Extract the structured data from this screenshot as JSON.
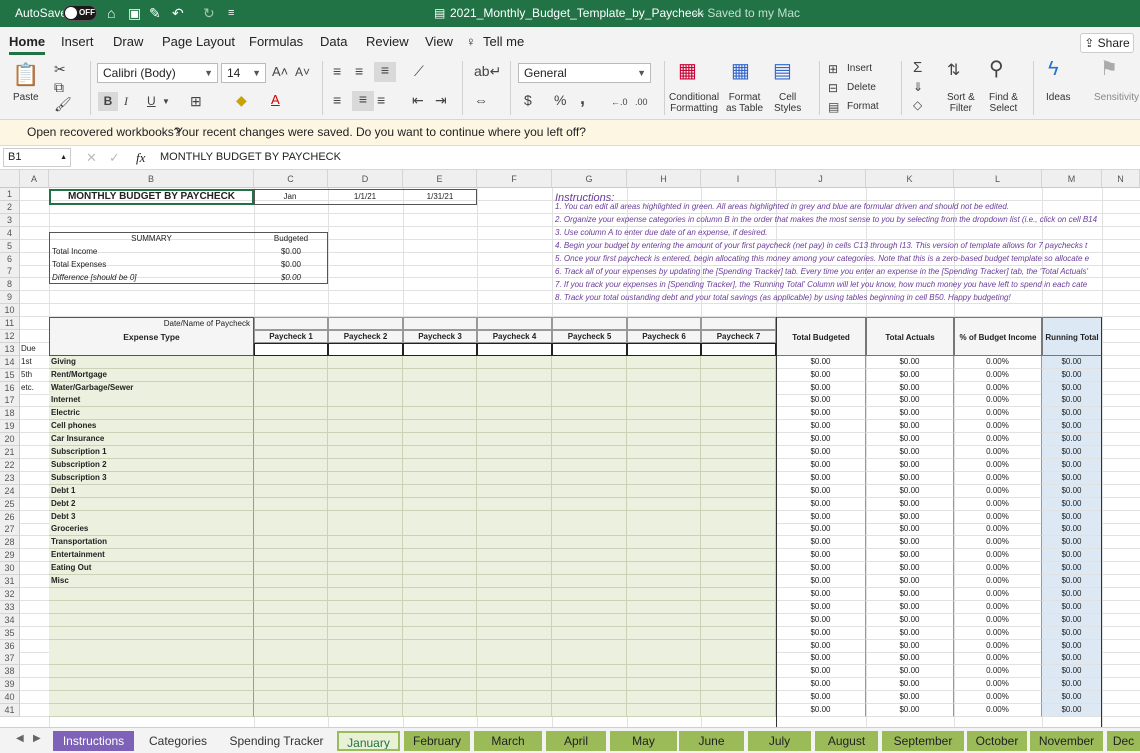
{
  "titlebar": {
    "autosave_label": "AutoSave",
    "autosave_state": "OFF",
    "filename": "2021_Monthly_Budget_Template_by_Paycheck",
    "saved_status": "— Saved to my Mac",
    "color": "#217346"
  },
  "ribbon_tabs": [
    "Home",
    "Insert",
    "Draw",
    "Page Layout",
    "Formulas",
    "Data",
    "Review",
    "View",
    "Tell me"
  ],
  "share_label": "Share",
  "ribbon": {
    "paste": "Paste",
    "font_name": "Calibri (Body)",
    "font_size": "14",
    "number_format": "General",
    "conditional": [
      "Conditional",
      "Formatting"
    ],
    "format_table": [
      "Format",
      "as Table"
    ],
    "cell_styles": [
      "Cell",
      "Styles"
    ],
    "insert": "Insert",
    "delete": "Delete",
    "format": "Format",
    "sort": [
      "Sort &",
      "Filter"
    ],
    "find": [
      "Find &",
      "Select"
    ],
    "ideas": "Ideas",
    "sensitivity": "Sensitivity",
    "bold": "B",
    "italic": "I",
    "underline": "U"
  },
  "banner": {
    "title": "Open recovered workbooks?",
    "message": "Your recent changes were saved. Do you want to continue where you left off?"
  },
  "formula_bar": {
    "name_box": "B1",
    "fx": "fx",
    "content": "MONTHLY BUDGET BY PAYCHECK"
  },
  "columns": [
    "A",
    "B",
    "C",
    "D",
    "E",
    "F",
    "G",
    "H",
    "I",
    "J",
    "K",
    "L",
    "M",
    "N"
  ],
  "rows": [
    "1",
    "2",
    "3",
    "4",
    "5",
    "6",
    "7",
    "8",
    "9",
    "10",
    "11",
    "12",
    "13",
    "14",
    "15",
    "16",
    "17",
    "18",
    "19",
    "20",
    "21",
    "22",
    "23",
    "24",
    "25",
    "26",
    "27",
    "28",
    "29",
    "30",
    "31",
    "32",
    "33",
    "34",
    "35",
    "36",
    "37",
    "38",
    "39",
    "40",
    "41"
  ],
  "sheet": {
    "title": "MONTHLY BUDGET BY PAYCHECK",
    "month": "Jan",
    "start_date": "1/1/21",
    "end_date": "1/31/21",
    "summary_header": "SUMMARY",
    "budgeted_header": "Budgeted",
    "summary_rows": [
      {
        "label": "Total Income",
        "value": "$0.00"
      },
      {
        "label": "Total Expenses",
        "value": "$0.00"
      },
      {
        "label": "Difference [should be 0]",
        "value": "$0.00"
      }
    ],
    "instructions_title": "Instructions:",
    "instructions": [
      "1. You can edit all areas highlighted in green. All areas highlighted in grey and blue are formular driven and should not be edited.",
      "2. Organize your expense categories in column B in the order that makes the most sense to you by selecting from the dropdown list (i.e., click on cell B14",
      "3. Use column A to enter due date of an expense, if desired.",
      "4. Begin your budget by entering the amount of your first paycheck (net pay) in cells  C13 through I13. This version of template allows for 7 paychecks t",
      "5. Once your first paycheck is entered, begin allocating this money among your categories. Note that this is a zero-based budget template so allocate e",
      "6. Track all of your expenses by updating the [Spending Tracker] tab. Every time you enter an expense in the [Spending Tracker] tab, the 'Total Actuals'",
      "7. If you track your expenses in [Spending Tracker], the 'Running Total' Column will let you know, how much money you have left to spend in each cate",
      "8. Track your total oustanding debt and your total savings (as applicable) by using tables beginning in cell B50. Happy budgeting!"
    ],
    "date_name_label": "Date/Name of Paycheck",
    "expense_type_header": "Expense Type",
    "paycheck_headers": [
      "Paycheck 1",
      "Paycheck 2",
      "Paycheck 3",
      "Paycheck 4",
      "Paycheck 5",
      "Paycheck 6",
      "Paycheck 7"
    ],
    "totals_headers": [
      "Total Budgeted",
      "Total Actuals",
      "% of Budget Income",
      "Running Total"
    ],
    "due_labels": [
      "Due",
      "1st",
      "5th",
      "etc."
    ],
    "categories": [
      "Giving",
      "Rent/Mortgage",
      "Water/Garbage/Sewer",
      "Internet",
      "Electric",
      "Cell phones",
      "Car Insurance",
      "Subscription 1",
      "Subscription 2",
      "Subscription 3",
      "Debt 1",
      "Debt 2",
      "Debt 3",
      "Groceries",
      "Transportation",
      "Entertainment",
      "Eating Out",
      "Misc"
    ],
    "money_zero": "$0.00",
    "pct_zero": "0.00%",
    "data_row_count": 28,
    "colors": {
      "green": "#ebf1de",
      "grey": "#efefef",
      "blue": "#dce9f5",
      "instructions": "#6a3d9a"
    }
  },
  "sheet_tabs": [
    {
      "label": "Instructions",
      "style": "purple"
    },
    {
      "label": "Categories",
      "style": "plain"
    },
    {
      "label": "Spending Tracker",
      "style": "plain"
    },
    {
      "label": "January",
      "style": "selected"
    },
    {
      "label": "February",
      "style": "month"
    },
    {
      "label": "March",
      "style": "month"
    },
    {
      "label": "April",
      "style": "month"
    },
    {
      "label": "May",
      "style": "month"
    },
    {
      "label": "June",
      "style": "month"
    },
    {
      "label": "July",
      "style": "month"
    },
    {
      "label": "August",
      "style": "month"
    },
    {
      "label": "September",
      "style": "month"
    },
    {
      "label": "October",
      "style": "month"
    },
    {
      "label": "November",
      "style": "month"
    },
    {
      "label": "Dec",
      "style": "month"
    }
  ]
}
